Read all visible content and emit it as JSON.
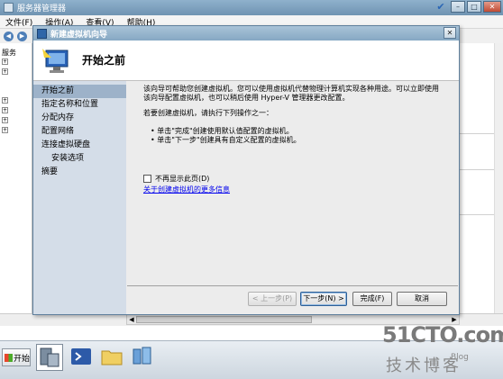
{
  "server_manager": {
    "title": "服务器管理器",
    "menu": [
      "文件(F)",
      "操作(A)",
      "查看(V)",
      "帮助(H)"
    ],
    "tree_label": "服务"
  },
  "wizard": {
    "title": "新建虚拟机向导",
    "header_title": "开始之前",
    "nav_items": [
      {
        "label": "开始之前",
        "active": true
      },
      {
        "label": "指定名称和位置"
      },
      {
        "label": "分配内存"
      },
      {
        "label": "配置网络"
      },
      {
        "label": "连接虚拟硬盘"
      },
      {
        "label": "安装选项",
        "sub": true
      },
      {
        "label": "摘要"
      }
    ],
    "intro_line1": "该向导可帮助您创建虚拟机。您可以使用虚拟机代替物理计算机实现各种用途。可以立即使用",
    "intro_line2": "该向导配置虚拟机，也可以稍后使用 Hyper-V 管理器更改配置。",
    "instruction": "若要创建虚拟机，请执行下列操作之一：",
    "bullet1": "单击\"完成\"创建使用默认值配置的虚拟机。",
    "bullet2": "单击\"下一步\"创建具有自定义配置的虚拟机。",
    "checkbox_label": "不再显示此页(D)",
    "more_info_link": "关于创建虚拟机的更多信息",
    "buttons": {
      "prev": "< 上一步(P)",
      "next": "下一步(N) >",
      "finish": "完成(F)",
      "cancel": "取消"
    }
  },
  "taskbar": {
    "start_label": "开始"
  },
  "watermark": {
    "main": "51CTO.com",
    "sub": "技术博客",
    "blog": "Blog"
  },
  "colors": {
    "nav_bg": "#d4dde8",
    "nav_active": "#9db2c9",
    "link": "#0000ee",
    "titlebar": "#86a8c3"
  }
}
